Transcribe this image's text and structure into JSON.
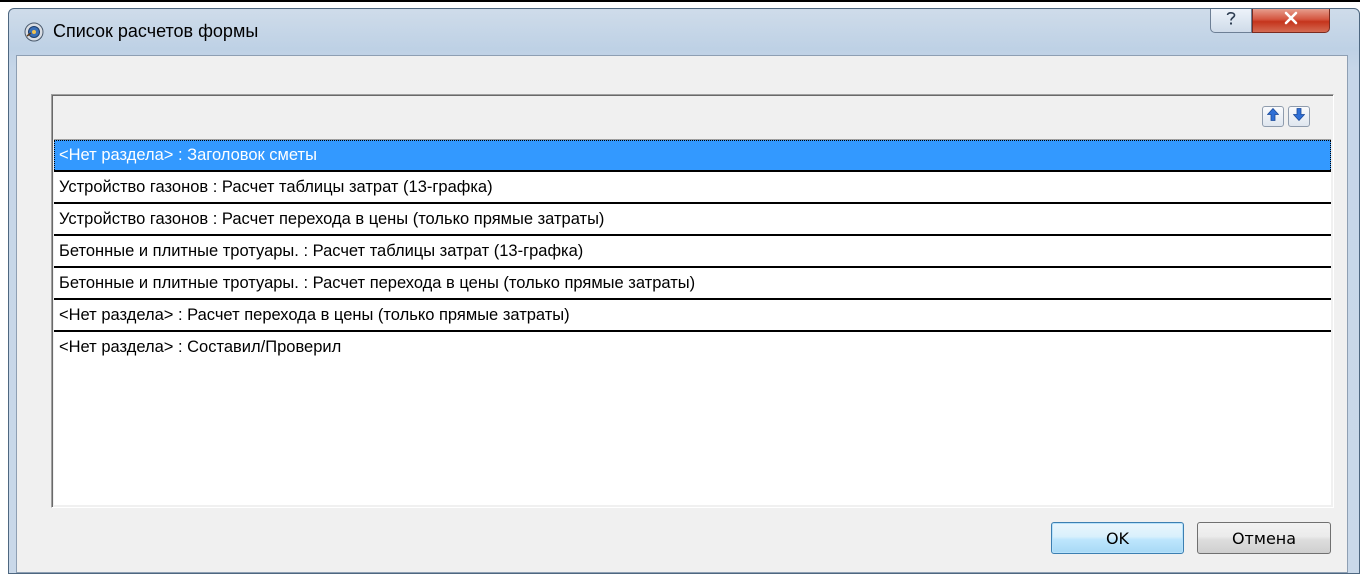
{
  "window": {
    "title": "Список расчетов формы",
    "help_label": "?",
    "close_label": "x"
  },
  "toolbar": {
    "move_up_icon": "arrow-up-icon",
    "move_down_icon": "arrow-down-icon"
  },
  "calculations": [
    {
      "label": "<Нет раздела> : Заголовок сметы",
      "selected": true
    },
    {
      "label": "Устройство газонов : Расчет таблицы затрат (13-графка)",
      "selected": false
    },
    {
      "label": "Устройство газонов : Расчет перехода в цены (только прямые затраты)",
      "selected": false
    },
    {
      "label": "Бетонные и плитные тротуары. : Расчет таблицы затрат (13-графка)",
      "selected": false
    },
    {
      "label": "Бетонные и плитные тротуары. : Расчет перехода в цены (только прямые затраты)",
      "selected": false
    },
    {
      "label": "<Нет раздела> : Расчет перехода в цены (только прямые затраты)",
      "selected": false
    },
    {
      "label": "<Нет раздела> : Составил/Проверил",
      "selected": false
    }
  ],
  "buttons": {
    "ok_label": "OK",
    "cancel_label": "Отмена"
  },
  "colors": {
    "selection": "#3399ff",
    "close_button": "#c5341c",
    "arrow_icon": "#2f6fd6"
  }
}
